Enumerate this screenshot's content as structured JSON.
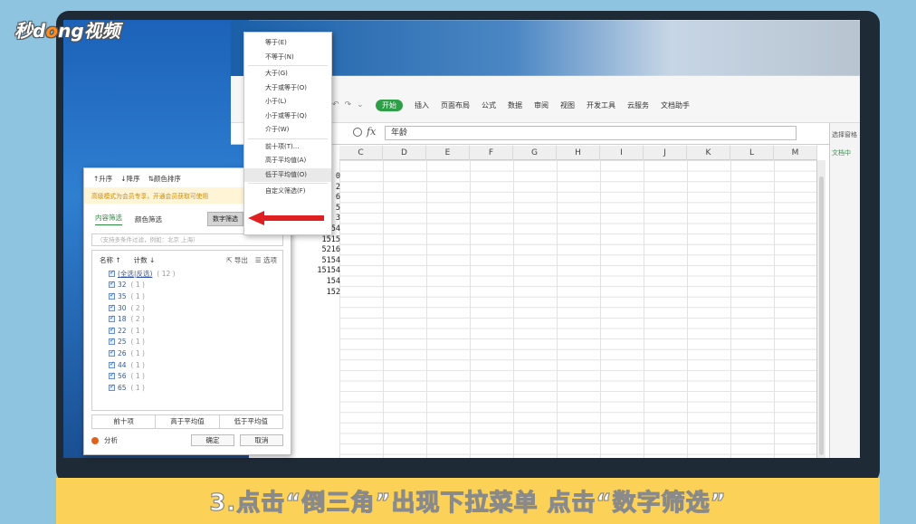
{
  "logo": {
    "part1": "秒d",
    "accent": "o",
    "part2": "ng视频"
  },
  "ribbon": {
    "quick_access": [
      "↶",
      "↷",
      "⌄"
    ],
    "tabs": [
      "开始",
      "插入",
      "页面布局",
      "公式",
      "数据",
      "审阅",
      "视图",
      "开发工具",
      "云服务",
      "文档助手"
    ],
    "active_tab": "开始"
  },
  "formula_bar": {
    "fx": "fx",
    "value": "年龄"
  },
  "columns": [
    "C",
    "D",
    "E",
    "F",
    "G",
    "H",
    "I",
    "J",
    "K",
    "L",
    "M"
  ],
  "cell_values": [
    "0",
    "2",
    "6",
    "5",
    "3",
    "154",
    "1515",
    "5216",
    "5154",
    "15154",
    "154",
    "152"
  ],
  "right_pane": {
    "title": "选择窗格",
    "link": "文档中"
  },
  "filter_panel": {
    "sort_asc": "升序",
    "sort_desc": "降序",
    "color_sort": "颜色排序",
    "promo": "高级模式为会员专享，开通会员获取可使用",
    "tab_content": "内容筛选",
    "tab_color": "颜色筛选",
    "number_filter": "数字筛选",
    "search_placeholder": "（支持多条件过滤，例如：北京 上海）",
    "header_name": "名称 ↑",
    "header_count": "计数 ↓",
    "export": "导出",
    "options": "选项",
    "select_all": "(全选|反选)",
    "select_all_count": "( 12 )",
    "items": [
      {
        "label": "32",
        "count": "( 1 )"
      },
      {
        "label": "35",
        "count": "( 1 )"
      },
      {
        "label": "30",
        "count": "( 2 )"
      },
      {
        "label": "18",
        "count": "( 2 )"
      },
      {
        "label": "22",
        "count": "( 1 )"
      },
      {
        "label": "25",
        "count": "( 1 )"
      },
      {
        "label": "26",
        "count": "( 1 )"
      },
      {
        "label": "44",
        "count": "( 1 )"
      },
      {
        "label": "56",
        "count": "( 1 )"
      },
      {
        "label": "65",
        "count": "( 1 )"
      }
    ],
    "quick_top10": "前十项",
    "quick_above_avg": "高于平均值",
    "quick_below_avg": "低于平均值",
    "analysis": "分析",
    "ok": "确定",
    "cancel": "取消"
  },
  "number_menu": {
    "items": [
      "等于(E)",
      "不等于(N)",
      "大于(G)",
      "大于或等于(O)",
      "小于(L)",
      "小于或等于(Q)",
      "介于(W)",
      "前十项(T)...",
      "高于平均值(A)",
      "低于平均值(O)",
      "自定义筛选(F)"
    ]
  },
  "caption": "3.点击“倒三角”出现下拉菜单 点击“数字筛选”",
  "colors": {
    "accent_green": "#2e9e47",
    "arrow_red": "#e02020",
    "banner_yellow": "#fcd157"
  }
}
